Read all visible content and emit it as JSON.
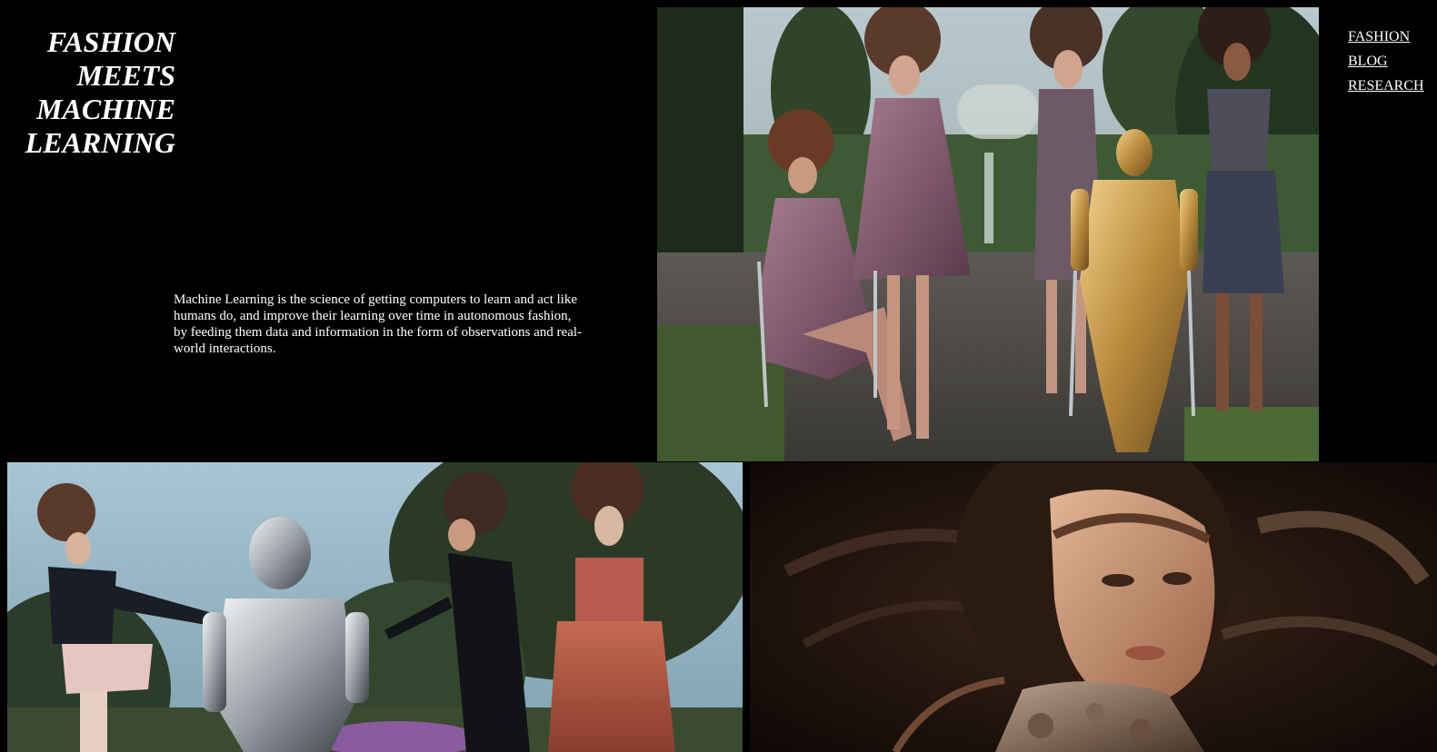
{
  "header": {
    "title_lines": [
      "FASHION",
      "MEETS",
      "MACHINE",
      "LEARNING"
    ]
  },
  "nav": {
    "items": [
      {
        "label": "FASHION"
      },
      {
        "label": "BLOG"
      },
      {
        "label": "RESEARCH"
      }
    ]
  },
  "intro": {
    "text": "Machine Learning is the science of getting computers to learn and act like humans do, and improve their learning over time in autonomous fashion, by feeding them data and information in the form of observations and real-world interactions."
  },
  "colors": {
    "background": "#000000",
    "text": "#ffffff"
  }
}
